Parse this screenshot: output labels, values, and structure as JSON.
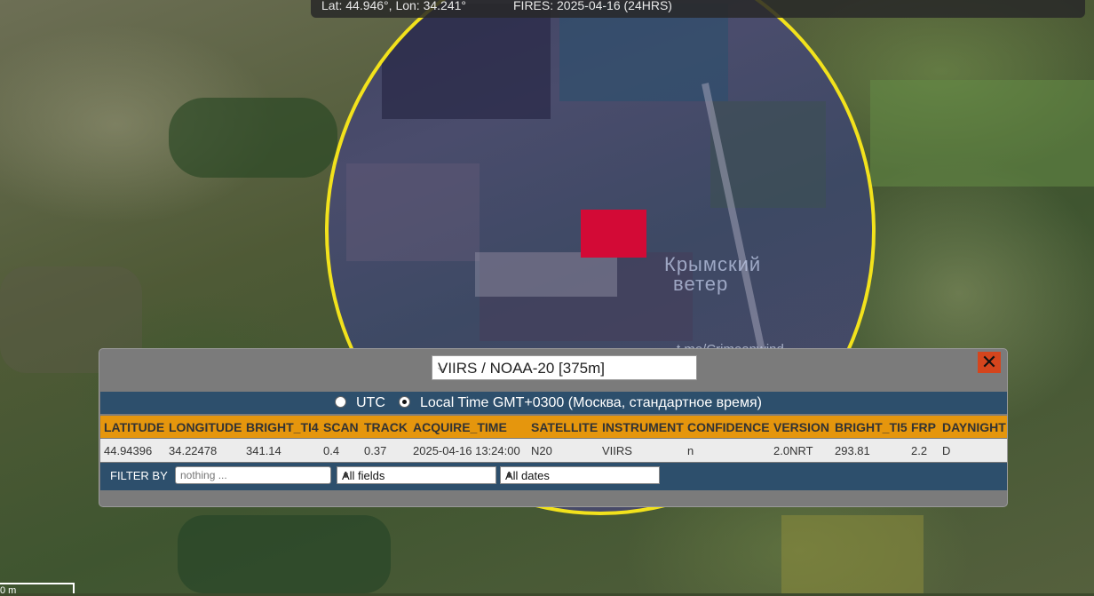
{
  "map": {
    "status_coords": "Lat: 44.946°, Lon: 34.241°",
    "status_fires": "FIRES: 2025-04-16 (24HRS)",
    "watermark_line1": "Крымский",
    "watermark_line2": "ветер",
    "watermark_handle": "t.me/Crimeanwind",
    "scale_label": "0 m"
  },
  "popup": {
    "satellite_select": "VIIRS / NOAA-20 [375m]",
    "close_label": "✕",
    "time": {
      "utc_label": "UTC",
      "local_label": "Local Time GMT+0300 (Москва, стандартное время)",
      "selected": "local"
    },
    "table": {
      "headers": [
        "LATITUDE",
        "LONGITUDE",
        "BRIGHT_TI4",
        "SCAN",
        "TRACK",
        "ACQUIRE_TIME",
        "SATELLITE",
        "INSTRUMENT",
        "CONFIDENCE",
        "VERSION",
        "BRIGHT_TI5",
        "FRP",
        "DAYNIGHT"
      ],
      "rows": [
        [
          "44.94396",
          "34.22478",
          "341.14",
          "0.4",
          "0.37",
          "2025-04-16 13:24:00",
          "N20",
          "VIIRS",
          "n",
          "2.0NRT",
          "293.81",
          "2.2",
          "D"
        ]
      ]
    },
    "filter": {
      "label": "FILTER BY",
      "placeholder": "nothing ...",
      "field_select": "All fields",
      "date_select": "All dates"
    }
  },
  "colors": {
    "ring": "#f2e21c",
    "fire_pixel": "#d30a36",
    "header_bg": "#e5960d",
    "bar_bg": "#2d4f6c",
    "close_bg": "#d4451d"
  }
}
